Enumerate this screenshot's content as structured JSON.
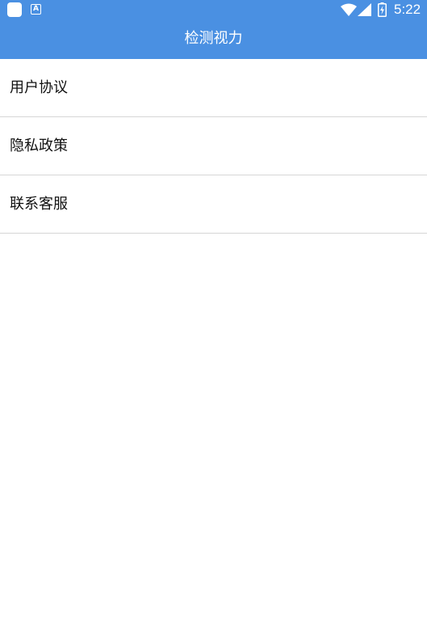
{
  "status_bar": {
    "time": "5:22",
    "icons": [
      "app-notification-icon",
      "a-icon",
      "wifi-icon",
      "cellular-signal-icon",
      "battery-charging-icon"
    ],
    "a_glyph": "A"
  },
  "header": {
    "title": "检测视力",
    "background_color": "#4a90e2"
  },
  "menu": {
    "items": [
      {
        "label": "用户协议"
      },
      {
        "label": "隐私政策"
      },
      {
        "label": "联系客服"
      }
    ]
  }
}
